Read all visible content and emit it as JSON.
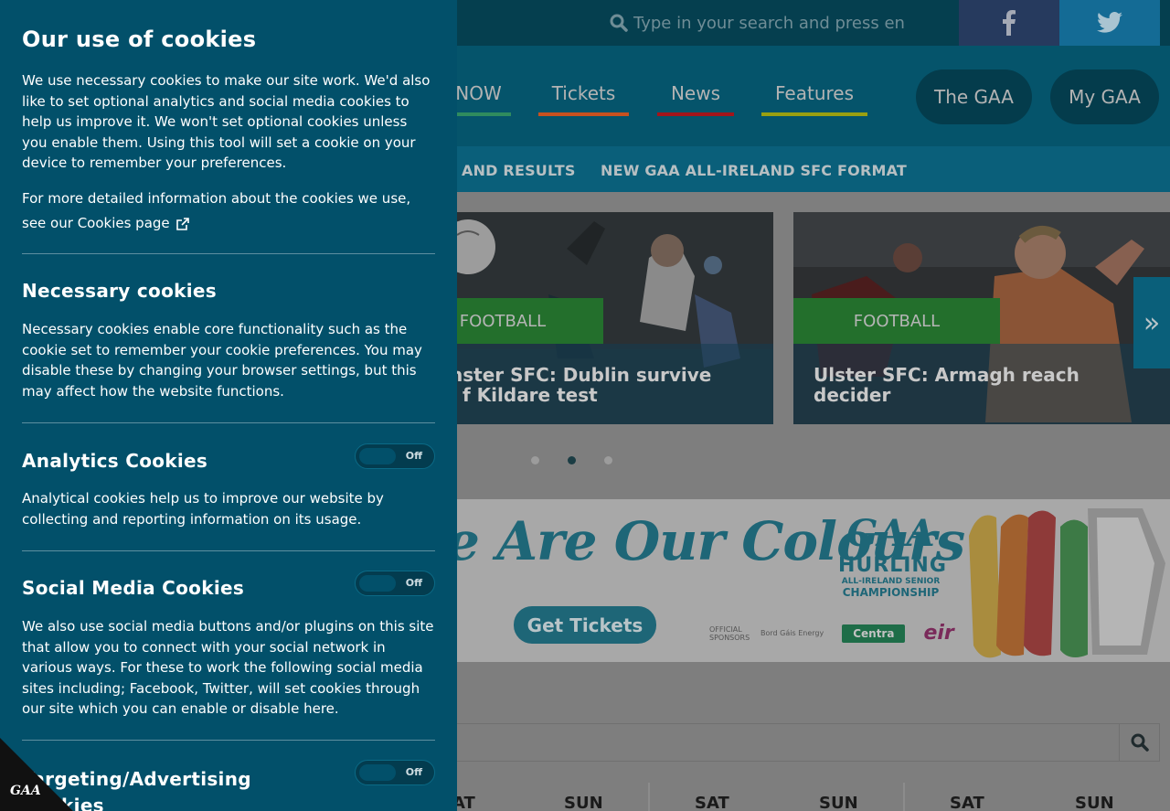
{
  "header": {
    "search_placeholder": "Type in your search and press en",
    "facebook_icon": "facebook-icon",
    "twitter_icon": "twitter-icon"
  },
  "nav": {
    "links": [
      {
        "label": "NOW",
        "color": "#2f8b5e"
      },
      {
        "label": "Tickets",
        "color": "#c8511f"
      },
      {
        "label": "News",
        "color": "#a3151b"
      },
      {
        "label": "Features",
        "color": "#9aa011"
      }
    ],
    "pills": [
      "The GAA",
      "My GAA"
    ]
  },
  "subnav": {
    "items": [
      "AND RESULTS",
      "NEW GAA ALL-IRELAND SFC FORMAT"
    ]
  },
  "carousel": {
    "cards": [
      {
        "tag": "FOOTBALL",
        "title_line1": "nster SFC: Dublin survive",
        "title_line2": "f Kildare test"
      },
      {
        "tag": "FOOTBALL",
        "title_line1": "Ulster SFC: Armagh reach",
        "title_line2": "decider"
      }
    ],
    "next_icon": "double-chevron-right-icon",
    "dots": 3,
    "active_dot": 2
  },
  "banner": {
    "headline": "e Are Our Colours",
    "cta": "Get Tickets",
    "logo_gaa": "GAA",
    "logo_line1": "HURLING",
    "logo_line2": "ALL-IRELAND SENIOR",
    "logo_line3": "CHAMPIONSHIP",
    "sponsor_label": "OFFICIAL SPONSORS",
    "sponsor1": "Bord Gáis Energy",
    "sponsor2": "Centra",
    "sponsor3": "eir"
  },
  "fixtures": {
    "search_icon": "search-icon",
    "days": [
      "SAT",
      "SUN",
      "SAT",
      "SUN",
      "SAT",
      "SUN"
    ]
  },
  "cookie": {
    "title": "Our use of cookies",
    "intro": "We use necessary cookies to make our site work. We'd also like to set optional analytics and social media cookies to help us improve it. We won't set optional cookies unless you enable them. Using this tool will set a cookie on your device to remember your preferences.",
    "more_info": "For more detailed information about the cookies we use, see our",
    "more_link": "Cookies page",
    "necessary_title": "Necessary cookies",
    "necessary_text": "Necessary cookies enable core functionality such as the cookie set to remember your cookie preferences. You may disable these by changing your browser settings, but this may affect how the website functions.",
    "analytics_title": "Analytics Cookies",
    "analytics_text": "Analytical cookies help us to improve our website by collecting and reporting information on its usage.",
    "social_title": "Social Media Cookies",
    "social_text": "We also use social media buttons and/or plugins on this site that allow you to connect with your social network in various ways. For these to work the following social media sites including; Facebook, Twitter, will set cookies through our site which you can enable or disable here.",
    "targeting_title_line1": "Targeting/Advertising",
    "targeting_title_line2": "Cookies",
    "toggle_off": "Off"
  },
  "corner_logo": "GAA"
}
